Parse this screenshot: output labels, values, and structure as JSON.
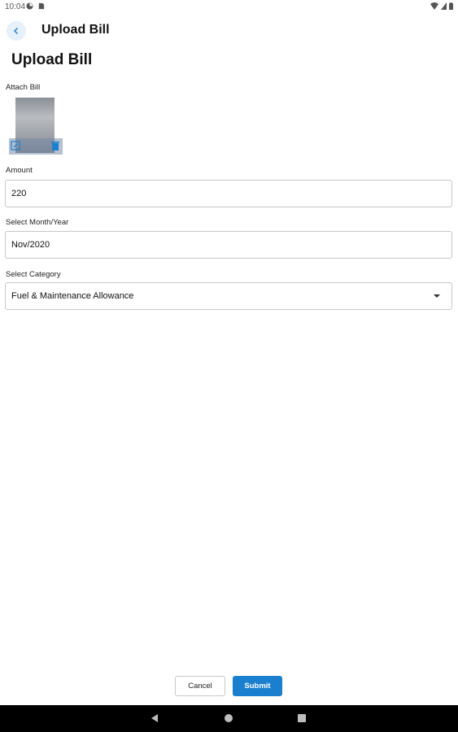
{
  "status_bar": {
    "time": "10:04",
    "icons": [
      "notification-icon",
      "sim-icon",
      "wifi-icon",
      "signal-icon",
      "battery-icon"
    ]
  },
  "app_bar": {
    "title": "Upload Bill",
    "back_icon": "chevron-left-icon"
  },
  "page": {
    "title": "Upload Bill"
  },
  "form": {
    "attach_label": "Attach Bill",
    "attachment_icons": [
      "edit-icon",
      "delete-icon"
    ],
    "amount_label": "Amount",
    "amount_value": "220",
    "month_label": "Select Month/Year",
    "month_value": "Nov/2020",
    "category_label": "Select Category",
    "category_value": "Fuel & Maintenance Allowance"
  },
  "actions": {
    "cancel_label": "Cancel",
    "submit_label": "Submit"
  },
  "colors": {
    "primary": "#1a7fcf",
    "back_button_bg": "#e6f1fb",
    "nav_bar": "#000000"
  },
  "nav_bar": {
    "icons": [
      "nav-back-icon",
      "nav-home-icon",
      "nav-recents-icon"
    ]
  }
}
